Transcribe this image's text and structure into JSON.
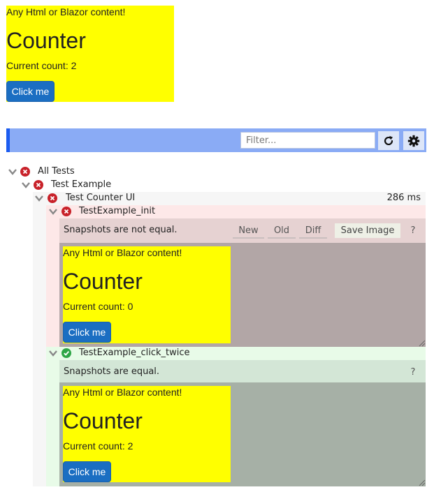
{
  "app_component": {
    "intro": "Any Html or Blazor content!",
    "heading": "Counter",
    "count_text": "Current count: 2",
    "button_label": "Click me"
  },
  "toolbar": {
    "filter_placeholder": "Filter...",
    "filter_value": "",
    "refresh_icon": "refresh-icon",
    "settings_icon": "gear-icon"
  },
  "tree": {
    "all_tests": {
      "label": "All Tests",
      "status": "failed"
    },
    "fixture": {
      "label": "Test Example",
      "status": "failed"
    },
    "group": {
      "label": "Test Counter UI",
      "status": "failed",
      "duration": "286 ms"
    },
    "tests": [
      {
        "label": "TestExample_init",
        "status": "failed",
        "message": "Snapshots are not equal.",
        "tabs": [
          "New",
          "Old",
          "Diff"
        ],
        "save_label": "Save Image",
        "help_label": "?",
        "snapshot": {
          "intro": "Any Html or Blazor content!",
          "heading": "Counter",
          "count_text": "Current count: 0",
          "button_label": "Click me"
        }
      },
      {
        "label": "TestExample_click_twice",
        "status": "passed",
        "message": "Snapshots are equal.",
        "help_label": "?",
        "snapshot": {
          "intro": "Any Html or Blazor content!",
          "heading": "Counter",
          "count_text": "Current count: 2",
          "button_label": "Click me"
        }
      }
    ]
  },
  "colors": {
    "toolbar_bg": "#8aabf5",
    "toolbar_accent": "#1c5cf0",
    "fail": "#c8222a",
    "pass": "#2ea646",
    "yellow": "#ffff00",
    "button_blue": "#1b6ec2"
  }
}
